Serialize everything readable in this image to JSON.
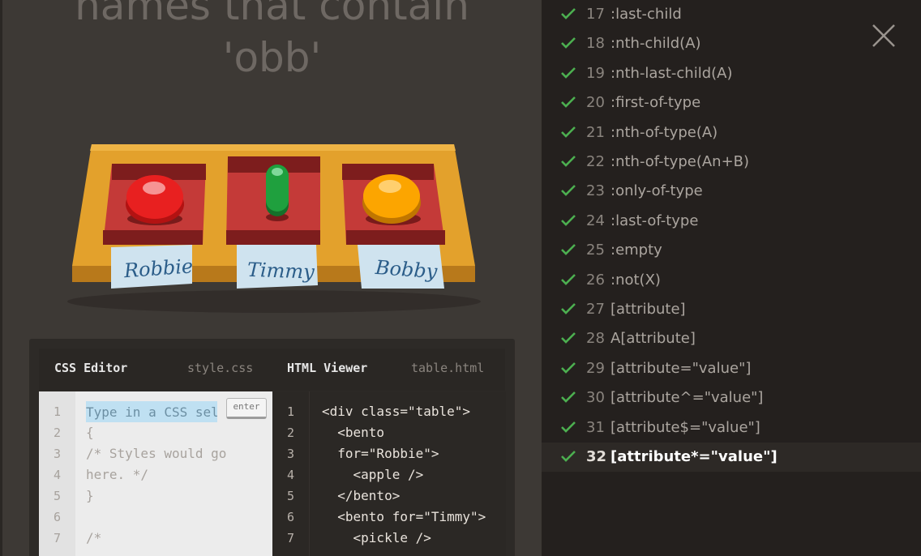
{
  "title": {
    "line1": "names that contain",
    "line2": "'obb'"
  },
  "bento_labels": [
    "Robbie",
    "Timmy",
    "Bobby"
  ],
  "editor": {
    "css_tab_label": "CSS Editor",
    "css_file": "style.css",
    "html_tab_label": "HTML Viewer",
    "html_file": "table.html",
    "input_placeholder": "Type in a CSS sel",
    "enter_label": "enter",
    "css_line_numbers": [
      "1",
      "2",
      "3",
      "4",
      "5",
      "6",
      "7"
    ],
    "css_lines": [
      "",
      "{",
      "/* Styles would go",
      "here. */",
      "}",
      "",
      "/*"
    ],
    "html_line_numbers": [
      "1",
      "2",
      "3",
      "4",
      "5",
      "6",
      "7"
    ],
    "html_lines": [
      "<div class=\"table\">",
      "  <bento",
      "  for=\"Robbie\">",
      "    <apple />",
      "  </bento>",
      "  <bento for=\"Timmy\">",
      "    <pickle />"
    ]
  },
  "levels": [
    {
      "num": "17",
      "name": ":last-child",
      "done": true
    },
    {
      "num": "18",
      "name": ":nth-child(A)",
      "done": true
    },
    {
      "num": "19",
      "name": ":nth-last-child(A)",
      "done": true
    },
    {
      "num": "20",
      "name": ":first-of-type",
      "done": true
    },
    {
      "num": "21",
      "name": ":nth-of-type(A)",
      "done": true
    },
    {
      "num": "22",
      "name": ":nth-of-type(An+B)",
      "done": true
    },
    {
      "num": "23",
      "name": ":only-of-type",
      "done": true
    },
    {
      "num": "24",
      "name": ":last-of-type",
      "done": true
    },
    {
      "num": "25",
      "name": ":empty",
      "done": true
    },
    {
      "num": "26",
      "name": ":not(X)",
      "done": true
    },
    {
      "num": "27",
      "name": "[attribute]",
      "done": true
    },
    {
      "num": "28",
      "name": "A[attribute]",
      "done": true
    },
    {
      "num": "29",
      "name": "[attribute=\"value\"]",
      "done": true
    },
    {
      "num": "30",
      "name": "[attribute^=\"value\"]",
      "done": true
    },
    {
      "num": "31",
      "name": "[attribute$=\"value\"]",
      "done": true
    },
    {
      "num": "32",
      "name": "[attribute*=\"value\"]",
      "done": true,
      "active": true
    }
  ],
  "colors": {
    "check": "#4caf50",
    "table_wood": "#e0a02a",
    "bento": "#9e2a2a",
    "apple": "#e52020",
    "pickle": "#1e9a3a",
    "orange": "#f5a000",
    "label_paper": "#cfe3ef"
  }
}
